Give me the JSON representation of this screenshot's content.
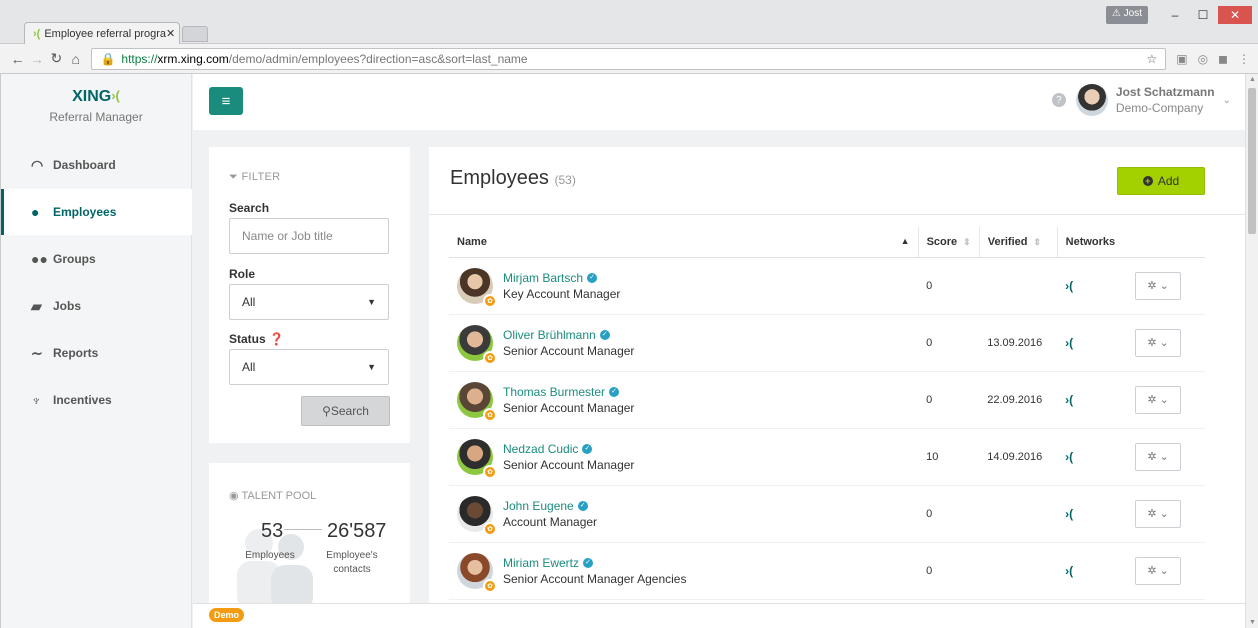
{
  "browser": {
    "tab_title": "Employee referral progra",
    "url_https": "https://",
    "url_host": "xrm.xing.com",
    "url_path": "/demo/admin/employees?direction=asc&sort=last_name",
    "profile_label": "Jost"
  },
  "sidebar": {
    "logo": "XING",
    "subtitle": "Referral Manager",
    "items": [
      {
        "label": "Dashboard",
        "icon": "dashboard-icon"
      },
      {
        "label": "Employees",
        "icon": "user-icon"
      },
      {
        "label": "Groups",
        "icon": "group-icon"
      },
      {
        "label": "Jobs",
        "icon": "briefcase-icon"
      },
      {
        "label": "Reports",
        "icon": "chart-icon"
      },
      {
        "label": "Incentives",
        "icon": "trophy-icon"
      }
    ]
  },
  "header": {
    "user_name": "Jost Schatzmann",
    "company": "Demo-Company"
  },
  "filter": {
    "title": "FILTER",
    "search_label": "Search",
    "search_placeholder": "Name or Job title",
    "role_label": "Role",
    "role_value": "All",
    "status_label": "Status",
    "status_value": "All",
    "search_button": "Search"
  },
  "talent_pool": {
    "title": "TALENT POOL",
    "employees_count": "53",
    "employees_label": "Employees",
    "contacts_count": "26'587",
    "contacts_label_1": "Employee's",
    "contacts_label_2": "contacts"
  },
  "main": {
    "title": "Employees",
    "count": "(53)",
    "add_button": "Add",
    "columns": {
      "name": "Name",
      "score": "Score",
      "verified": "Verified",
      "networks": "Networks"
    },
    "rows": [
      {
        "name": "Mirjam Bartsch",
        "title": "Key Account Manager",
        "score": "0",
        "verified": ""
      },
      {
        "name": "Oliver Brühlmann",
        "title": "Senior Account Manager",
        "score": "0",
        "verified": "13.09.2016"
      },
      {
        "name": "Thomas Burmester",
        "title": "Senior Account Manager",
        "score": "0",
        "verified": "22.09.2016"
      },
      {
        "name": "Nedzad Cudic",
        "title": "Senior Account Manager",
        "score": "10",
        "verified": "14.09.2016"
      },
      {
        "name": "John Eugene",
        "title": "Account Manager",
        "score": "0",
        "verified": ""
      },
      {
        "name": "Miriam Ewertz",
        "title": "Senior Account Manager Agencies",
        "score": "0",
        "verified": ""
      }
    ]
  },
  "footer": {
    "badge": "Demo"
  },
  "colors": {
    "accent": "#006567",
    "button_teal": "#1a8c7d",
    "add_green": "#a3d100",
    "badge_orange": "#f39c12"
  }
}
